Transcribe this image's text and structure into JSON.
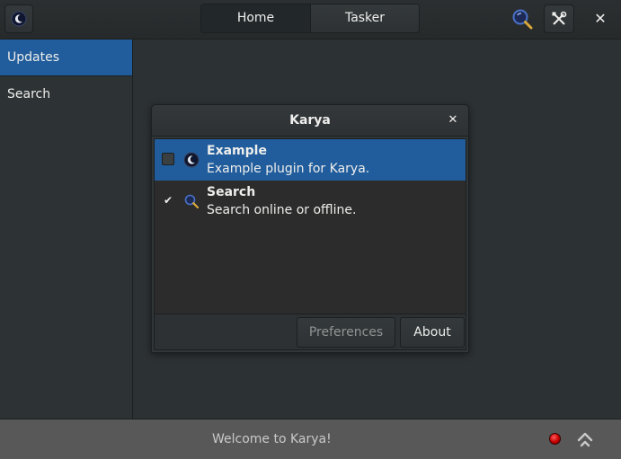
{
  "header": {
    "app_icon": "moon-icon",
    "tabs": [
      {
        "label": "Home",
        "active": true
      },
      {
        "label": "Tasker",
        "active": false
      }
    ],
    "search_icon": "search-icon",
    "tools_icon": "tools-icon",
    "close_symbol": "✕"
  },
  "sidebar": {
    "items": [
      {
        "label": "Updates",
        "selected": true
      },
      {
        "label": "Search",
        "selected": false
      }
    ]
  },
  "dialog": {
    "title": "Karya",
    "close_symbol": "✕",
    "plugins": [
      {
        "name": "Example",
        "description": "Example plugin for Karya.",
        "enabled": false,
        "selected": true,
        "icon": "moon-icon"
      },
      {
        "name": "Search",
        "description": "Search online or offline.",
        "enabled": true,
        "selected": false,
        "icon": "search-icon"
      }
    ],
    "buttons": {
      "preferences": "Preferences",
      "about": "About"
    }
  },
  "statusbar": {
    "message": "Welcome to Karya!",
    "indicator_color": "#d40000"
  },
  "colors": {
    "accent": "#215d9c",
    "background": "#2c3133"
  }
}
